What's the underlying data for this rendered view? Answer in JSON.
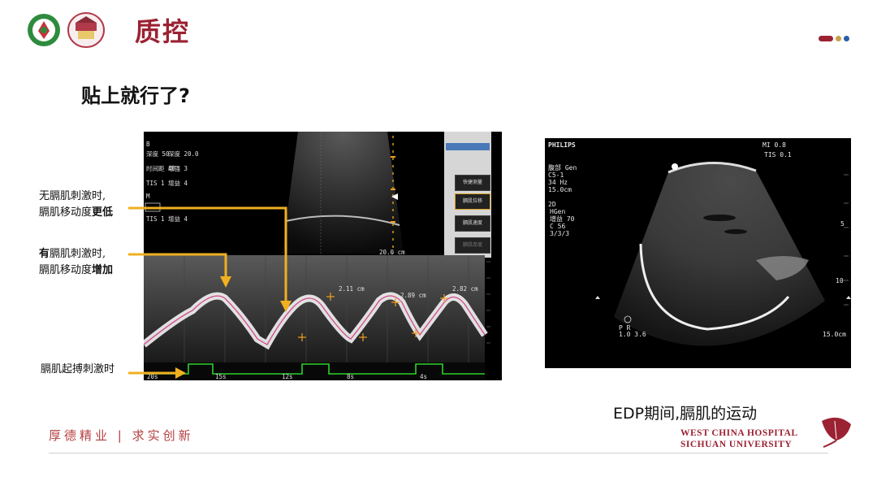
{
  "header": {
    "title": "质控",
    "colors": {
      "brand": "#9b2232",
      "dot1": "#9b2232",
      "dot2": "#c9a04b",
      "dot3": "#2a5fa8"
    }
  },
  "slide": {
    "subtitle": "贴上就行了?",
    "annotations": {
      "no_stim_line1": "无膈肌刺激时,",
      "no_stim_line2_prefix": "膈肌移动度",
      "no_stim_line2_emph": "更低",
      "with_stim_line1_prefix": "",
      "with_stim_line1_emph": "有",
      "with_stim_line1_rest": "膈肌刺激时,",
      "with_stim_line2_prefix": "膈肌移动度",
      "with_stim_line2_emph": "增加",
      "pacing": "膈肌起搏刺激时"
    },
    "caption": "EDP期间,膈肌的运动"
  },
  "left_ultrasound": {
    "depth_label": "20.0 cm",
    "panel_buttons": [
      "快捷测量",
      "膈肌位移",
      "膈肌速度",
      "膈肌厚度"
    ],
    "peak_labels": [
      "2.11 cm",
      "2.82 cm",
      "2.89 cm"
    ],
    "axis_labels": [
      "20s",
      "15s",
      "12s",
      "8s",
      "4s"
    ]
  },
  "right_ultrasound": {
    "brand": "PHILIPS",
    "mi": "MI 0.8",
    "tis": "TIS 0.1",
    "params": [
      "腹部 Gen",
      "C5-1",
      "34 Hz",
      "15.0cm",
      "",
      "2D",
      "HGen",
      "增益 70",
      "C 56",
      "3/3/3"
    ],
    "depth": "15.0cm",
    "marker": "P R",
    "scale": "1.0 3.6"
  },
  "footer": {
    "motto": "厚德精业 | 求实创新",
    "hospital_line1": "WEST CHINA HOSPITAL",
    "hospital_line2": "SICHUAN UNIVERSITY"
  }
}
